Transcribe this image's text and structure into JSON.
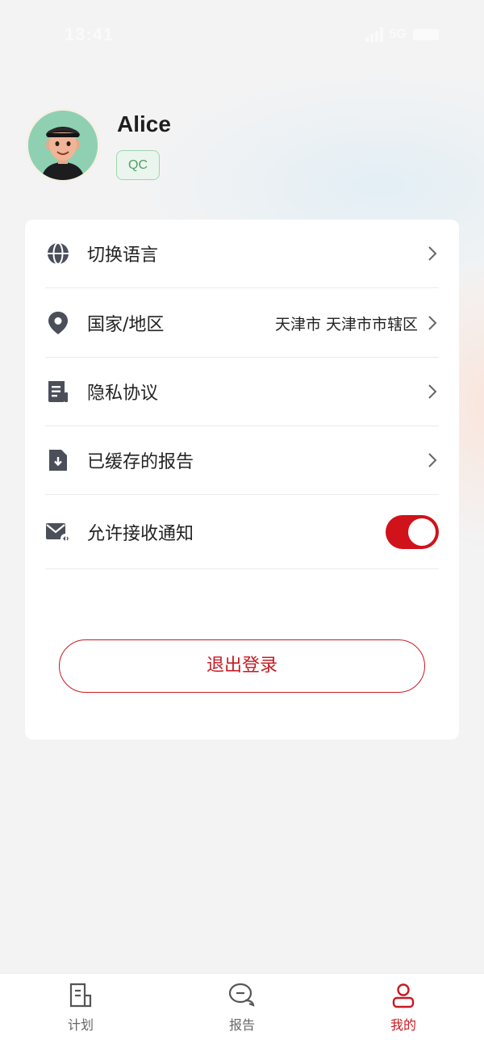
{
  "status_bar": {
    "time": "13:41",
    "network": "5G"
  },
  "profile": {
    "name": "Alice",
    "role": "QC"
  },
  "menu": {
    "items": [
      {
        "label": "切换语言",
        "value": ""
      },
      {
        "label": "国家/地区",
        "value": "天津市 天津市市辖区"
      },
      {
        "label": "隐私协议",
        "value": ""
      },
      {
        "label": "已缓存的报告",
        "value": ""
      },
      {
        "label": "允许接收通知",
        "value": ""
      }
    ],
    "notifications_enabled": true
  },
  "logout_label": "退出登录",
  "tabbar": {
    "tabs": [
      {
        "label": "计划",
        "icon": "plan-doc-icon"
      },
      {
        "label": "报告",
        "icon": "chat-bubble-icon"
      },
      {
        "label": "我的",
        "icon": "user-icon",
        "active": true
      }
    ]
  },
  "colors": {
    "accent": "#c71a22",
    "toggle_on": "#d0121b",
    "badge": "#4f9e65"
  }
}
